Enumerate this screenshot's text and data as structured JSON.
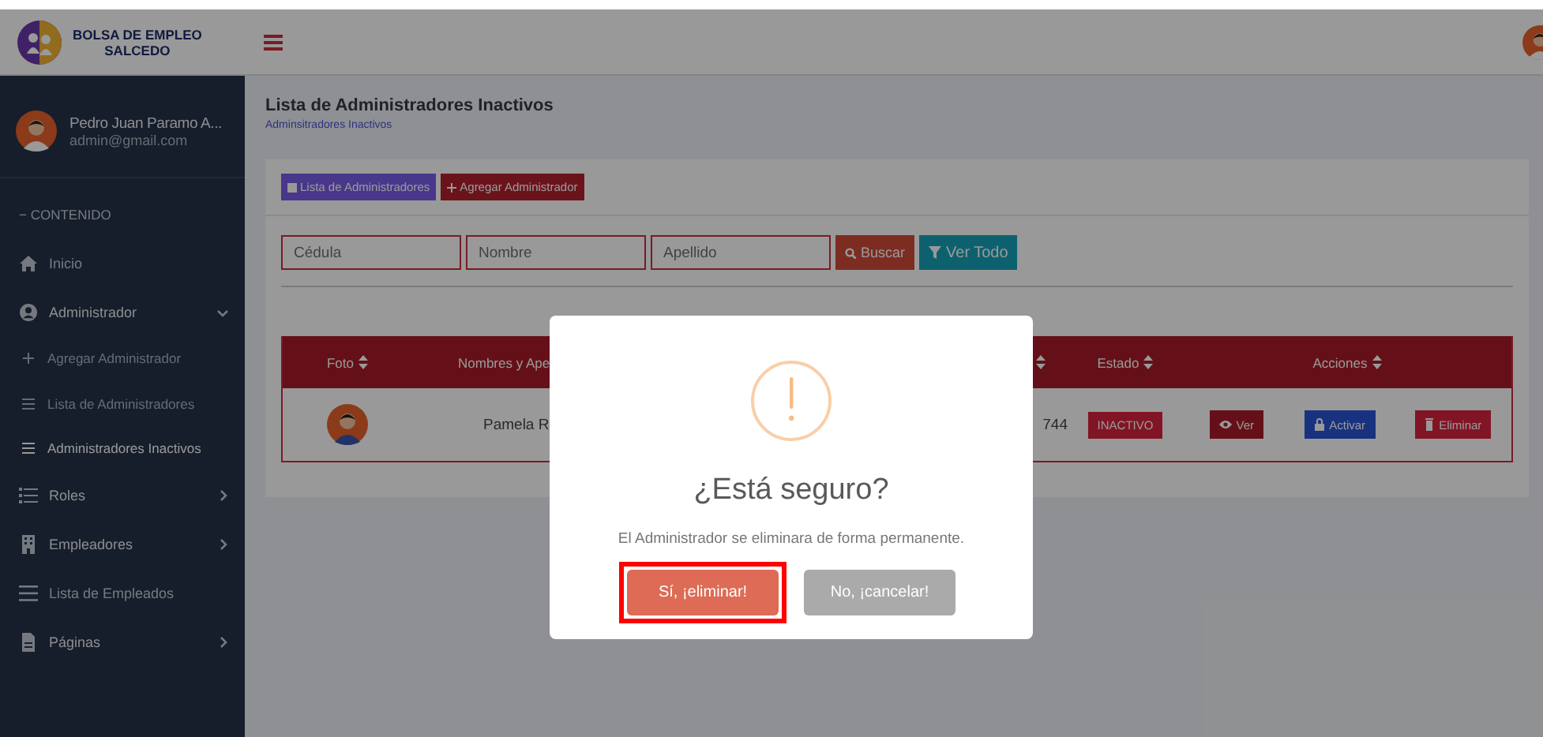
{
  "header": {
    "logo_lines": [
      "BOLSA DE EMPLEO",
      "SALCEDO"
    ]
  },
  "sidebar": {
    "user": {
      "name": "Pedro Juan Paramo A...",
      "email": "admin@gmail.com"
    },
    "section": "− CONTENIDO",
    "items": [
      {
        "label": "Inicio",
        "kind": "link"
      },
      {
        "label": "Administrador",
        "kind": "group",
        "expanded": true,
        "children": [
          {
            "label": "Agregar Administrador",
            "kind": "add",
            "selected": false
          },
          {
            "label": "Lista de Administradores",
            "kind": "list",
            "selected": false
          },
          {
            "label": "Administradores Inactivos",
            "kind": "list",
            "selected": true
          }
        ]
      },
      {
        "label": "Roles",
        "kind": "group",
        "expanded": false
      },
      {
        "label": "Empleadores",
        "kind": "group",
        "expanded": false
      },
      {
        "label": "Lista de Empleados",
        "kind": "link"
      },
      {
        "label": "Páginas",
        "kind": "group",
        "expanded": false
      }
    ]
  },
  "page": {
    "title": "Lista de Administradores Inactivos",
    "breadcrumb": "Adminsitradores Inactivos"
  },
  "actions": [
    {
      "label": "Lista de Administradores",
      "kind": "list"
    },
    {
      "label": "Agregar Administrador",
      "kind": "add"
    }
  ],
  "search": {
    "fields": [
      {
        "placeholder": "Cédula"
      },
      {
        "placeholder": "Nombre"
      },
      {
        "placeholder": "Apellido"
      }
    ],
    "buttons": [
      {
        "label": "Buscar",
        "kind": "search"
      },
      {
        "label": "Ver Todo",
        "kind": "filter"
      }
    ]
  },
  "table": {
    "columns": [
      {
        "label": "Foto",
        "sort_icon": true
      },
      {
        "label": "Nombres y Ape",
        "sort_icon": false
      },
      {
        "sort_icon": true
      },
      {
        "label": "Estado",
        "sort_icon": true
      },
      {
        "label": "Acciones",
        "sort_icon": true
      }
    ],
    "rows": [
      {
        "name": "Pamela R",
        "column_3": "744",
        "status": "INACTIVO",
        "actions": [
          {
            "label": "Ver",
            "kind": "view"
          },
          {
            "label": "Activar",
            "kind": "activate"
          },
          {
            "label": "Eliminar",
            "kind": "delete"
          }
        ]
      }
    ]
  },
  "dialog": {
    "title": "¿Está seguro?",
    "message": "El Administrador se eliminara de forma permanente.",
    "buttons": [
      {
        "label": "Sí, ¡eliminar!",
        "kind": "confirm",
        "highlighted": true
      },
      {
        "label": "No, ¡cancelar!",
        "kind": "cancel",
        "highlighted": false
      }
    ]
  }
}
